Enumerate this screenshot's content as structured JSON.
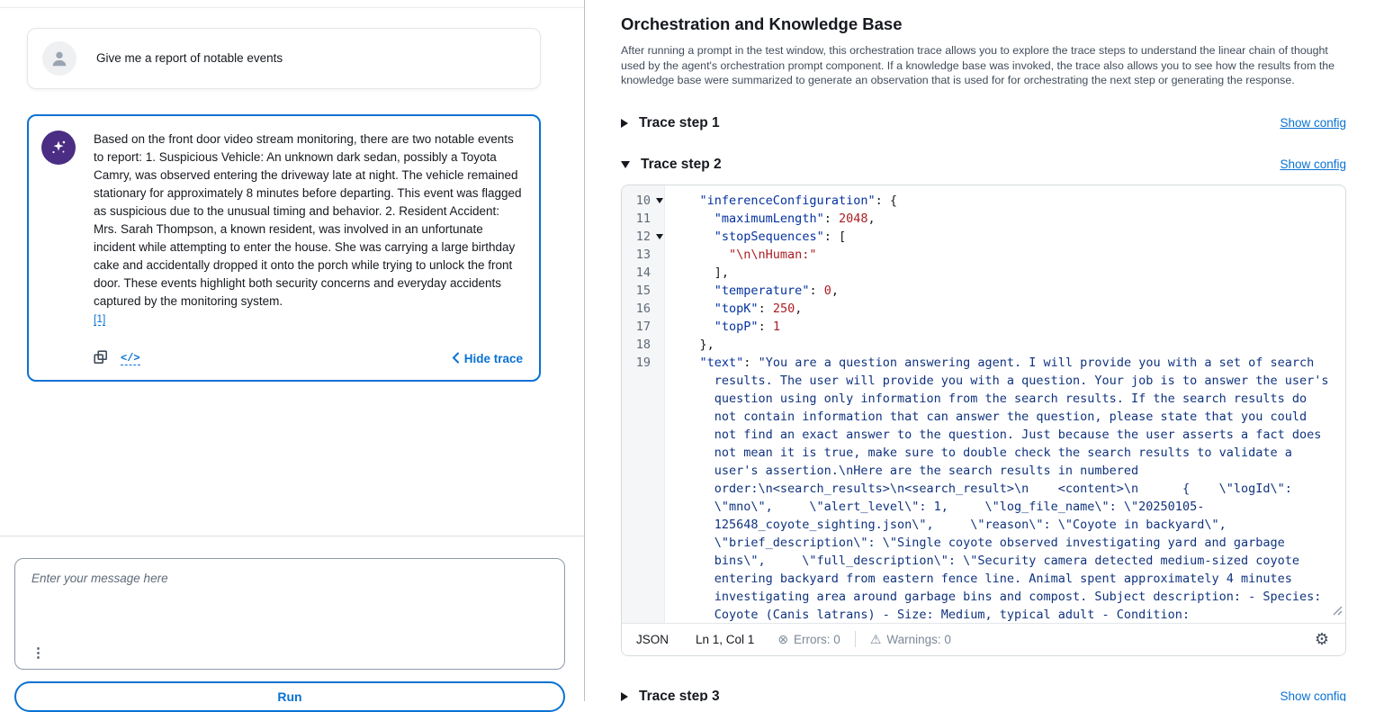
{
  "colors": {
    "accent": "#0972d3",
    "agent_icon": "#4b2d83",
    "code_key": "#0431a0",
    "code_number": "#ab1d22",
    "code_string": "#ab1d22",
    "code_text": "#10337f"
  },
  "icons": {
    "gear": "⚙",
    "warning": "⚠",
    "error": "⊗",
    "ellipsis": "⋮",
    "code": "</>"
  },
  "left_panel": {
    "user_message": "Give me a report of notable events",
    "agent_response": {
      "text": "Based on the front door video stream monitoring, there are two notable events to report: 1. Suspicious Vehicle: An unknown dark sedan, possibly a Toyota Camry, was observed entering the driveway late at night. The vehicle remained stationary for approximately 8 minutes before departing. This event was flagged as suspicious due to the unusual timing and behavior. 2. Resident Accident: Mrs. Sarah Thompson, a known resident, was involved in an unfortunate incident while attempting to enter the house. She was carrying a large birthday cake and accidentally dropped it onto the porch while trying to unlock the front door. These events highlight both security concerns and everyday accidents captured by the monitoring system.",
      "citation": "[1]",
      "hide_trace_label": "Hide trace"
    },
    "input": {
      "placeholder": "Enter your message here"
    },
    "run_label": "Run"
  },
  "right_panel": {
    "title": "Orchestration and Knowledge Base",
    "description": "After running a prompt in the test window, this orchestration trace allows you to explore the trace steps to understand the linear chain of thought used by the agent's orchestration prompt component. If a knowledge base was invoked, the trace also allows you to see how the results from the knowledge base were summarized to generate an observation that is used for for orchestrating the next step or generating the response.",
    "show_config_label": "Show config",
    "steps": [
      {
        "label": "Trace step 1",
        "expanded": false
      },
      {
        "label": "Trace step 2",
        "expanded": true
      },
      {
        "label": "Trace step 3",
        "expanded": false
      }
    ],
    "editor": {
      "lines": [
        {
          "num": "10",
          "fold": true,
          "segs": [
            {
              "t": "p",
              "s": "    "
            },
            {
              "t": "key",
              "s": "\"inferenceConfiguration\""
            },
            {
              "t": "p",
              "s": ": {"
            }
          ]
        },
        {
          "num": "11",
          "segs": [
            {
              "t": "p",
              "s": "      "
            },
            {
              "t": "key",
              "s": "\"maximumLength\""
            },
            {
              "t": "p",
              "s": ": "
            },
            {
              "t": "num",
              "s": "2048"
            },
            {
              "t": "p",
              "s": ","
            }
          ]
        },
        {
          "num": "12",
          "fold": true,
          "segs": [
            {
              "t": "p",
              "s": "      "
            },
            {
              "t": "key",
              "s": "\"stopSequences\""
            },
            {
              "t": "p",
              "s": ": ["
            }
          ]
        },
        {
          "num": "13",
          "segs": [
            {
              "t": "p",
              "s": "        "
            },
            {
              "t": "str",
              "s": "\"\\n\\nHuman:\""
            }
          ]
        },
        {
          "num": "14",
          "segs": [
            {
              "t": "p",
              "s": "      ],"
            }
          ]
        },
        {
          "num": "15",
          "segs": [
            {
              "t": "p",
              "s": "      "
            },
            {
              "t": "key",
              "s": "\"temperature\""
            },
            {
              "t": "p",
              "s": ": "
            },
            {
              "t": "num",
              "s": "0"
            },
            {
              "t": "p",
              "s": ","
            }
          ]
        },
        {
          "num": "16",
          "segs": [
            {
              "t": "p",
              "s": "      "
            },
            {
              "t": "key",
              "s": "\"topK\""
            },
            {
              "t": "p",
              "s": ": "
            },
            {
              "t": "num",
              "s": "250"
            },
            {
              "t": "p",
              "s": ","
            }
          ]
        },
        {
          "num": "17",
          "segs": [
            {
              "t": "p",
              "s": "      "
            },
            {
              "t": "key",
              "s": "\"topP\""
            },
            {
              "t": "p",
              "s": ": "
            },
            {
              "t": "num",
              "s": "1"
            }
          ]
        },
        {
          "num": "18",
          "segs": [
            {
              "t": "p",
              "s": "    },"
            }
          ]
        },
        {
          "num": "19",
          "segs": [
            {
              "t": "p",
              "s": "    "
            },
            {
              "t": "key",
              "s": "\"text\""
            },
            {
              "t": "p",
              "s": ": "
            },
            {
              "t": "txt",
              "s": "\"You are a question answering agent. I will provide you with a set of search results. The user will provide you with a question. Your job is to answer the user's question using only information from the search results. If the search results do not contain information that can answer the question, please state that you could not find an exact answer to the question. Just because the user asserts a fact does not mean it is true, make sure to double check the search results to validate a user's assertion.\\nHere are the search results in numbered order:\\n<search_results>\\n<search_result>\\n    <content>\\n      {    \\\"logId\\\": \\\"mno\\\",     \\\"alert_level\\\": 1,     \\\"log_file_name\\\": \\\"20250105-125648_coyote_sighting.json\\\",     \\\"reason\\\": \\\"Coyote in backyard\\\",     \\\"brief_description\\\": \\\"Single coyote observed investigating yard and garbage bins\\\",     \\\"full_description\\\": \\\"Security camera detected medium-sized coyote entering backyard from eastern fence line. Animal spent approximately 4 minutes investigating area around garbage bins and compost. Subject description: - Species: Coyote (Canis latrans) - Size: Medium, typical adult - Condition:"
            }
          ]
        }
      ],
      "status": {
        "language": "JSON",
        "cursor": "Ln 1, Col 1",
        "errors_label": "Errors: 0",
        "warnings_label": "Warnings: 0"
      }
    }
  }
}
